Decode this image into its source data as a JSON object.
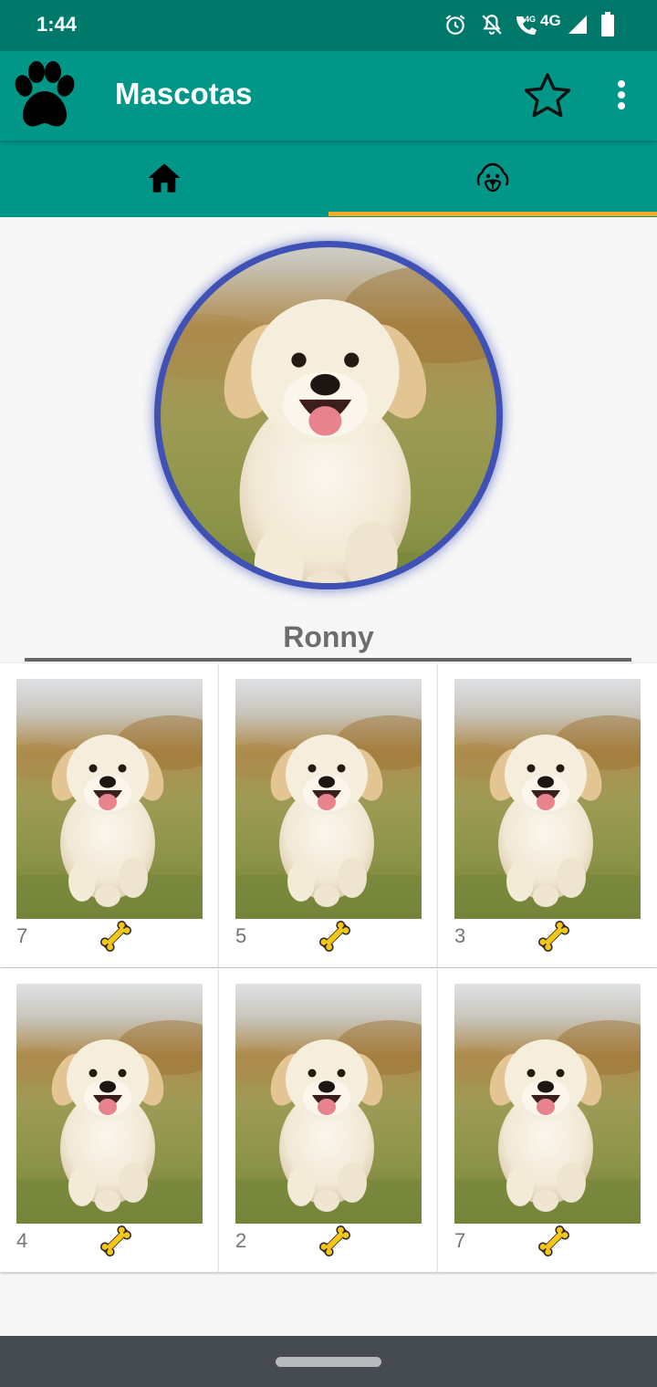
{
  "status_bar": {
    "time": "1:44",
    "network_label": "4G",
    "call_badge": "4G",
    "icons": [
      "alarm-icon",
      "mute-icon",
      "wifi-calling-icon",
      "signal-icon",
      "battery-icon"
    ]
  },
  "app_bar": {
    "title": "Mascotas",
    "logo_icon": "paw-icon",
    "actions": [
      "star-icon",
      "overflow-menu-icon"
    ],
    "background": "#009688"
  },
  "tabs": [
    {
      "icon": "home-icon",
      "selected": false
    },
    {
      "icon": "dog-face-icon",
      "selected": true
    }
  ],
  "tab_indicator_color": "#f9a825",
  "profile": {
    "name": "Ronny",
    "ring_color": "#3f51b5"
  },
  "photos": [
    {
      "likes": "7"
    },
    {
      "likes": "5"
    },
    {
      "likes": "3"
    },
    {
      "likes": "4"
    },
    {
      "likes": "2"
    },
    {
      "likes": "7"
    }
  ],
  "like_icon": "bone-icon",
  "like_icon_color": "#f5c518"
}
